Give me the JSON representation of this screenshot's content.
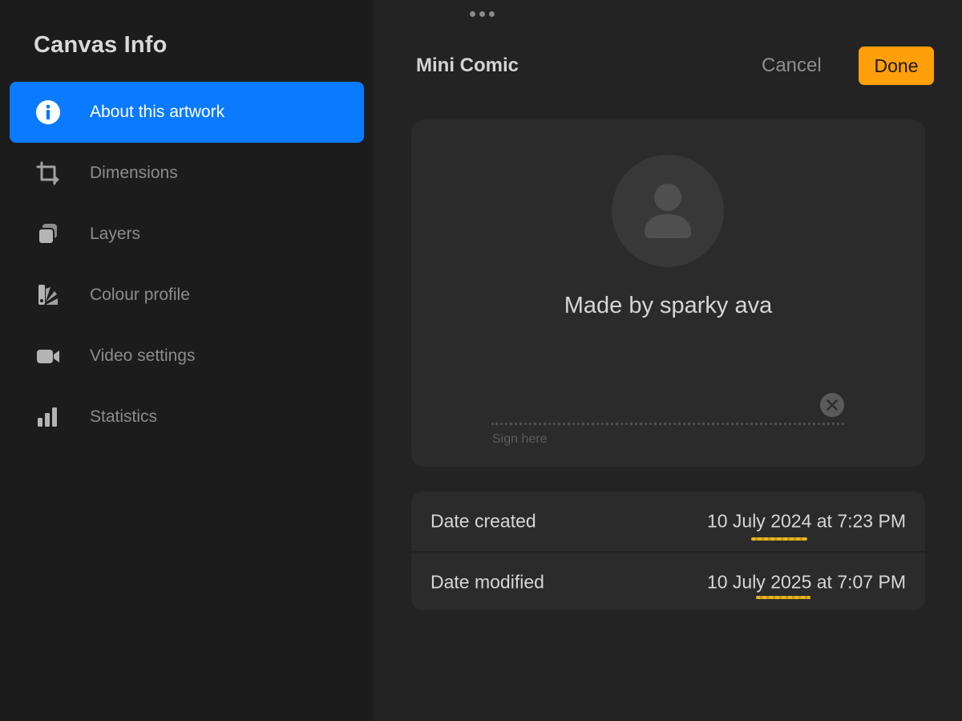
{
  "sidebar": {
    "title": "Canvas Info",
    "items": [
      {
        "label": "About this artwork",
        "icon": "info-icon",
        "active": true
      },
      {
        "label": "Dimensions",
        "icon": "crop-icon",
        "active": false
      },
      {
        "label": "Layers",
        "icon": "layers-icon",
        "active": false
      },
      {
        "label": "Colour profile",
        "icon": "colour-swatch-icon",
        "active": false
      },
      {
        "label": "Video settings",
        "icon": "video-camera-icon",
        "active": false
      },
      {
        "label": "Statistics",
        "icon": "bar-chart-icon",
        "active": false
      }
    ]
  },
  "header": {
    "title": "Mini Comic",
    "cancel_label": "Cancel",
    "done_label": "Done"
  },
  "author": {
    "made_by": "Made by sparky ava",
    "sign_placeholder": "Sign here"
  },
  "dates": {
    "created_label": "Date created",
    "created_value": "10 July 2024 at 7:23 PM",
    "modified_label": "Date modified",
    "modified_value": "10 July 2025 at 7:07 PM"
  },
  "colors": {
    "accent": "#0a7aff",
    "done_button": "#ff9f0a",
    "highlight_scribble": "#e8b41f"
  }
}
